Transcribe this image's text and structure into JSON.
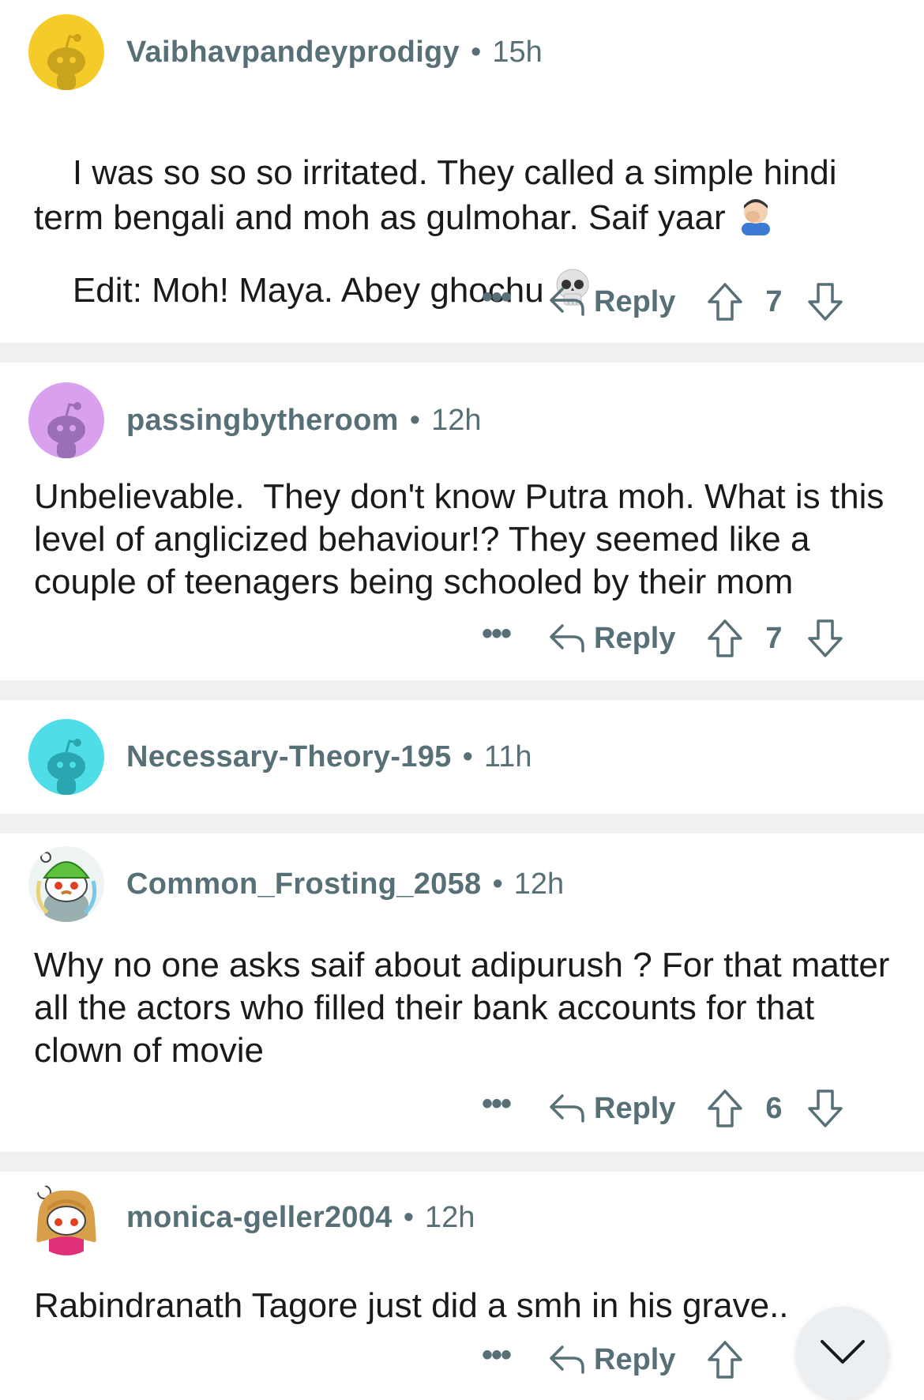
{
  "comments": [
    {
      "username": "Vaibhavpandeyprodigy",
      "time": "15h",
      "avatar_color": "#f5cb2a",
      "avatar_icon": "snoo-avatar-yellow",
      "paragraph1": "I was so so so irritated. They called a simple hindi term bengali and moh as gulmohar. Saif yaar",
      "paragraph1_emoji": "facepalm-emoji",
      "paragraph2": "Edit: Moh! Maya. Abey ghochu",
      "paragraph2_emoji": "skull-emoji",
      "more": "•••",
      "reply": "Reply",
      "score": "7"
    },
    {
      "username": "passingbytheroom",
      "time": "12h",
      "avatar_color": "#d9a0ee",
      "avatar_icon": "snoo-avatar-purple",
      "text": "Unbelievable.  They don't know Putra moh. What is this level of anglicized behaviour!? They seemed like a couple of teenagers being schooled by their mom",
      "more": "•••",
      "reply": "Reply",
      "score": "7"
    },
    {
      "username": "Necessary-Theory-195",
      "time": "11h",
      "avatar_color": "#4fdde8",
      "avatar_icon": "snoo-avatar-cyan"
    },
    {
      "username": "Common_Frosting_2058",
      "time": "12h",
      "avatar_icon": "custom-snoo-avatar-green-hat",
      "text": "Why no one asks saif about adipurush ? For that matter all the actors who filled their bank accounts for that clown of movie",
      "more": "•••",
      "reply": "Reply",
      "score": "6"
    },
    {
      "username": "monica-geller2004",
      "time": "12h",
      "avatar_icon": "custom-snoo-avatar-red-hair",
      "text": "Rabindranath Tagore just did a smh in his grave..",
      "more": "•••",
      "reply": "Reply"
    }
  ],
  "dot": "•",
  "scroll_button_icon": "chevron-down-icon",
  "colors": {
    "meta": "#576f76",
    "separator": "#eef0f2",
    "text": "#1a1a1b"
  }
}
